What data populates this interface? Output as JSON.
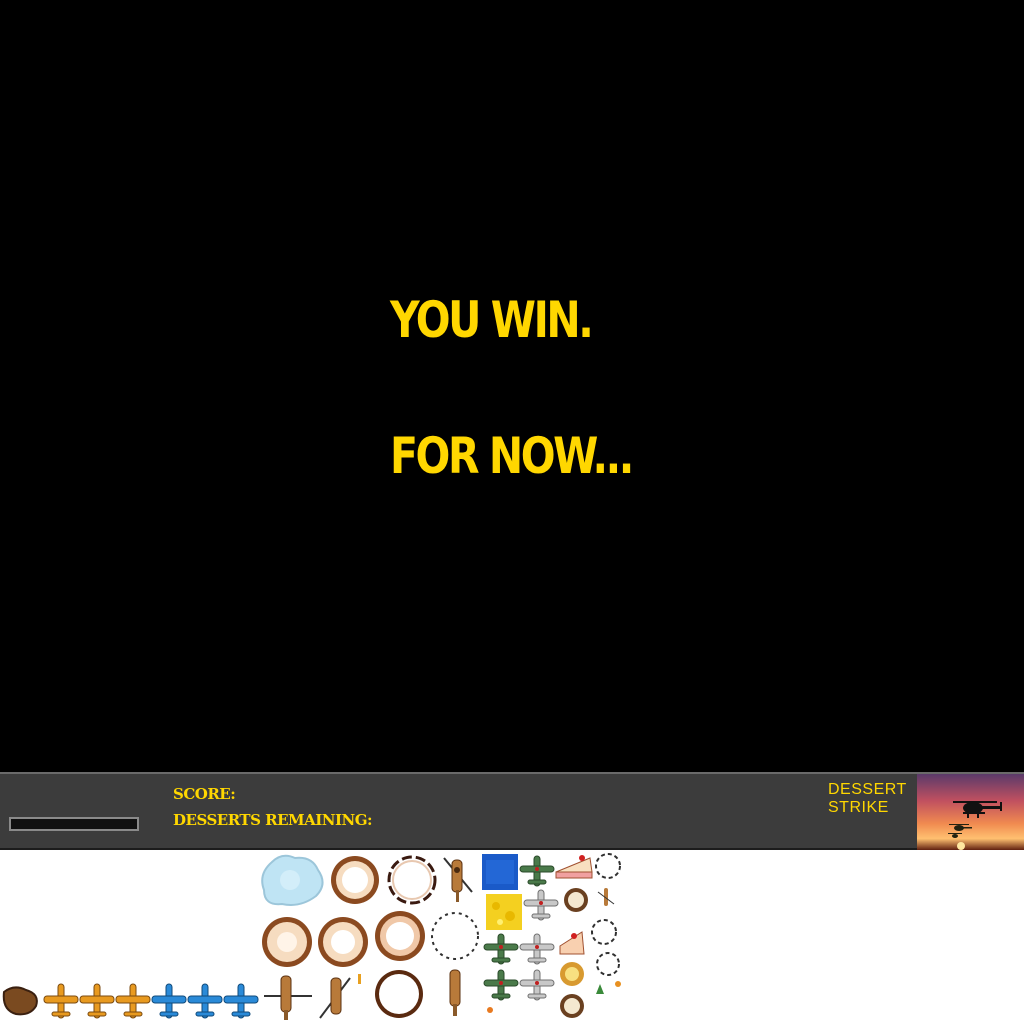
{
  "game": {
    "message_line_1": "YOU WIN.",
    "message_line_2": "FOR NOW..."
  },
  "hud": {
    "score_label": "SCORE:",
    "desserts_remaining_label": "DESSERTS REMAINING:",
    "health_fraction": 0.0,
    "title_line_1": "DESSERT",
    "title_line_2": "STRIKE"
  },
  "colors": {
    "background": "#000000",
    "accent_yellow": "#ffd700",
    "hud_background": "#3c3c3c"
  },
  "sprite_sheet": {
    "sprites": [
      "ice-cloud",
      "explosion-ring",
      "explosion-ring",
      "explosion-ring-broken",
      "explosion-ring-broken",
      "helicopter-topdown",
      "helicopter-topdown",
      "helicopter-topdown",
      "helicopter-topdown",
      "blue-water-tile",
      "yellow-sponge-tile",
      "green-fighter-plane",
      "grey-fighter-plane",
      "cake-slice",
      "dessert-cookie",
      "small-puff",
      "debris-chunk",
      "orange-fighter-plane",
      "blue-fighter-plane"
    ]
  }
}
